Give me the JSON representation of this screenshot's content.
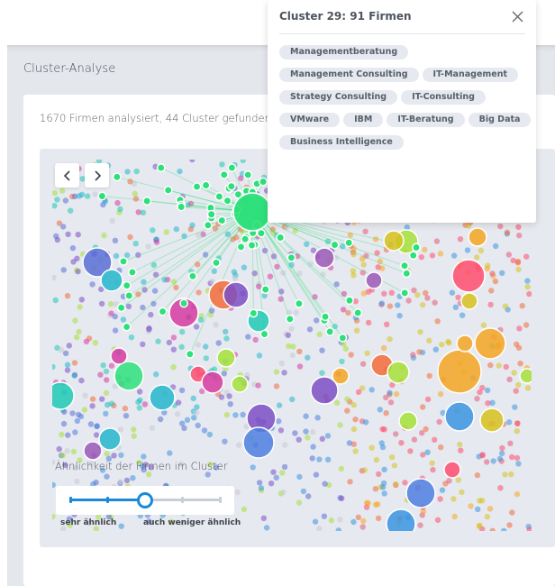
{
  "page": {
    "section_title": "Cluster-Analyse",
    "summary": "1670 Firmen analysiert, 44 Cluster gefunden"
  },
  "graph": {
    "nav": {
      "prev_icon": "chevron-left-icon",
      "next_icon": "chevron-right-icon"
    },
    "selected_cluster_color": "#2ee07a",
    "palette": [
      "#2ee07a",
      "#5b6fd6",
      "#24b6cc",
      "#f26b3a",
      "#7b4fc4",
      "#d63aa0",
      "#1fc9b4",
      "#ff4d6d",
      "#f5a623",
      "#a5e03a",
      "#d6c21f",
      "#3a95e0",
      "#e85a7a",
      "#9b59b6",
      "#4c7fe0",
      "#c6cbd6"
    ]
  },
  "similarity": {
    "label": "Ähnlichkeit der Firmen im Cluster",
    "min_label": "sehr ähnlich",
    "max_label": "auch weniger ähnlich",
    "steps": 5,
    "value_index": 2,
    "accent_color": "#1a8ad8"
  },
  "popup": {
    "title": "Cluster 29: 91 Firmen",
    "close_icon": "close-icon",
    "tags": [
      "Managementberatung",
      "Management Consulting",
      "IT-Management",
      "Strategy Consulting",
      "IT-Consulting",
      "VMware",
      "IBM",
      "IT-Beratung",
      "Big Data",
      "Business Intelligence"
    ]
  }
}
